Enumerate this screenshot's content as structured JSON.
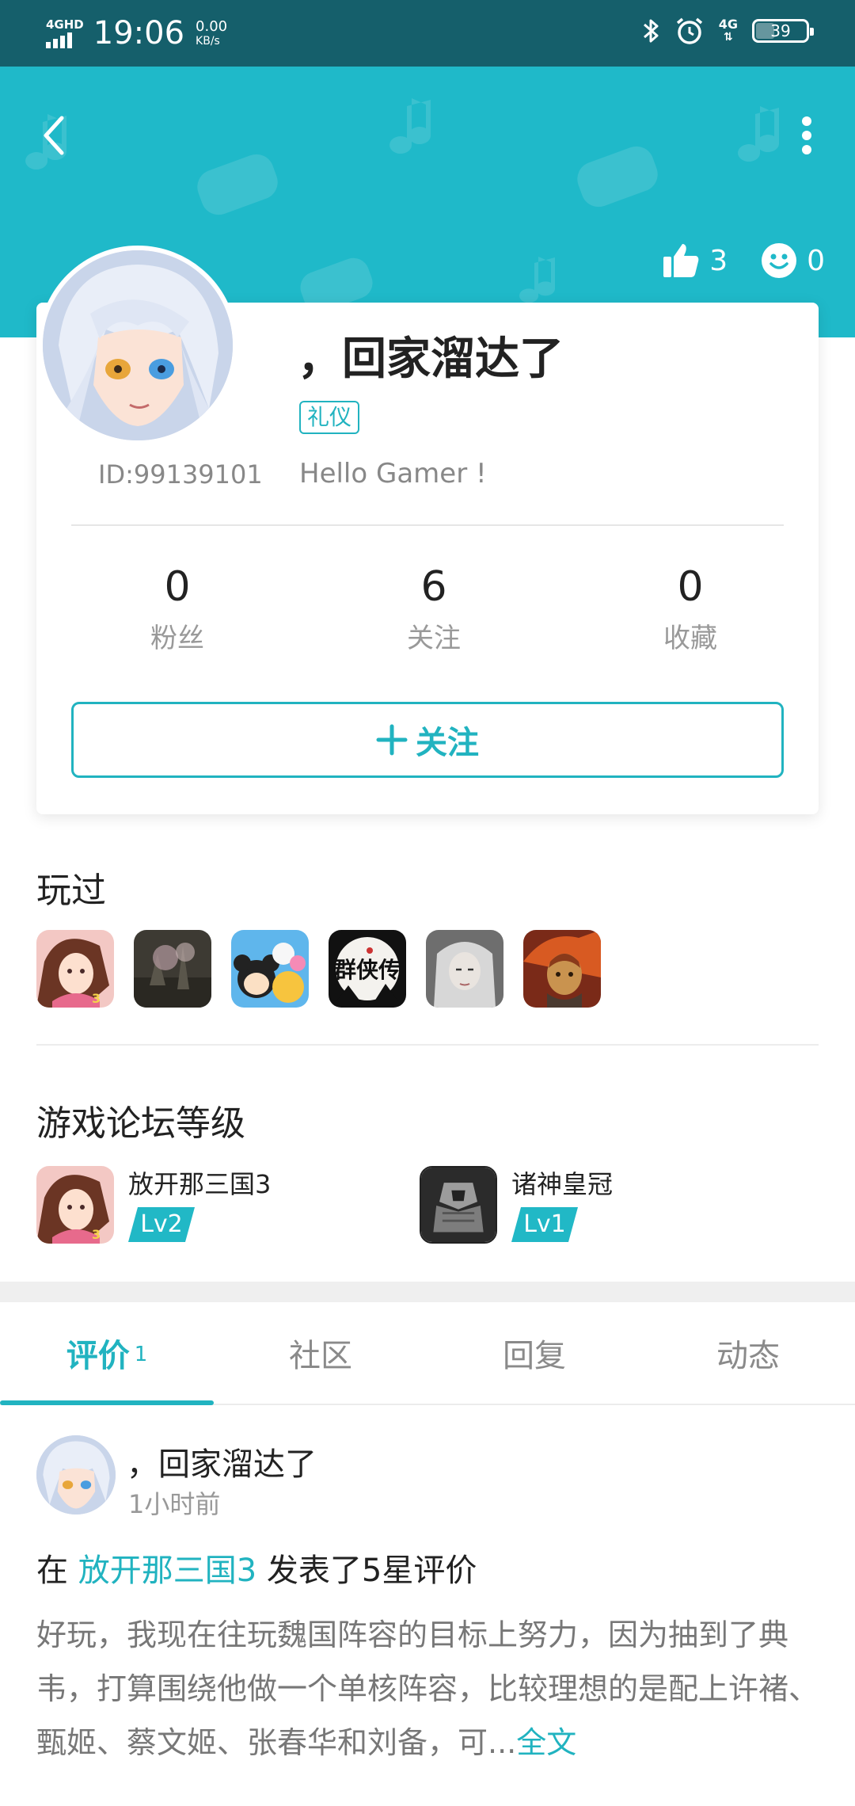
{
  "status_bar": {
    "network": "4GHD",
    "time": "19:06",
    "speed_value": "0.00",
    "speed_unit": "KB/s",
    "network_right": "4G",
    "battery": "39"
  },
  "header": {
    "likes": "3",
    "smiles": "0"
  },
  "profile": {
    "username": "，回家溜达了",
    "tag": "礼仪",
    "id": "ID:99139101",
    "bio": "Hello Gamer !",
    "stats": [
      {
        "num": "0",
        "label": "粉丝"
      },
      {
        "num": "6",
        "label": "关注"
      },
      {
        "num": "0",
        "label": "收藏"
      }
    ],
    "follow_label": "关注"
  },
  "played": {
    "title": "玩过",
    "games": [
      {
        "icon": "game-sanguo-icon"
      },
      {
        "icon": "game-landscape-icon"
      },
      {
        "icon": "game-tsum-icon"
      },
      {
        "icon": "game-qunxia-icon"
      },
      {
        "icon": "game-silver-hair-icon"
      },
      {
        "icon": "game-warrior-icon"
      }
    ]
  },
  "forum": {
    "title": "游戏论坛等级",
    "items": [
      {
        "name": "放开那三国3",
        "level": "Lv2"
      },
      {
        "name": "诸神皇冠",
        "level": "Lv1"
      }
    ]
  },
  "tabs": [
    {
      "label": "评价",
      "count": "1"
    },
    {
      "label": "社区",
      "count": ""
    },
    {
      "label": "回复",
      "count": ""
    },
    {
      "label": "动态",
      "count": ""
    }
  ],
  "post": {
    "user": "，回家溜达了",
    "time": "1小时前",
    "prefix": "在 ",
    "game": "放开那三国3",
    "suffix": " 发表了5星评价",
    "body": "好玩，我现在往玩魏国阵容的目标上努力，因为抽到了典韦，打算围绕他做一个单核阵容，比较理想的是配上许褚、甄姬、蔡文姬、张春华和刘备，可...",
    "more": "全文"
  },
  "colors": {
    "accent": "#21b3c0",
    "header_bg": "#1fb9c9",
    "status_bg": "#155f6b"
  }
}
